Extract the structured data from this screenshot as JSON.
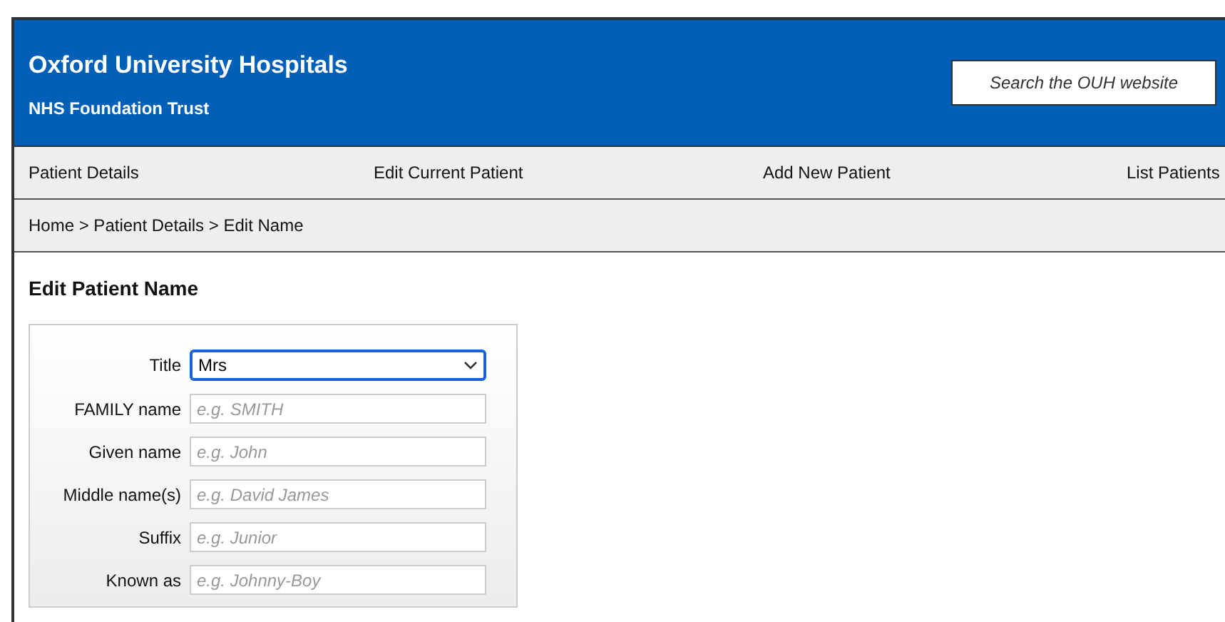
{
  "header": {
    "title": "Oxford University Hospitals",
    "subtitle": "NHS Foundation Trust",
    "search": {
      "placeholder": "Search the OUH website"
    }
  },
  "nav": [
    {
      "label": "Patient Details"
    },
    {
      "label": "Edit Current Patient"
    },
    {
      "label": "Add New Patient"
    },
    {
      "label": "List Patients"
    }
  ],
  "breadcrumb": "Home > Patient Details > Edit Name",
  "heading": "Edit Patient Name",
  "form": [
    {
      "kind": "select",
      "label": "Title",
      "value": "Mrs",
      "focused": true
    },
    {
      "kind": "text",
      "label": "FAMILY name",
      "placeholder": "e.g. SMITH",
      "focused": false
    },
    {
      "kind": "text",
      "label": "Given name",
      "placeholder": "e.g. John",
      "focused": false
    },
    {
      "kind": "text",
      "label": "Middle name(s)",
      "placeholder": "e.g. David James",
      "focused": false
    },
    {
      "kind": "text",
      "label": "Suffix",
      "placeholder": "e.g. Junior",
      "focused": false
    },
    {
      "kind": "text",
      "label": "Known as",
      "placeholder": "e.g. Johnny-Boy",
      "focused": false
    }
  ]
}
